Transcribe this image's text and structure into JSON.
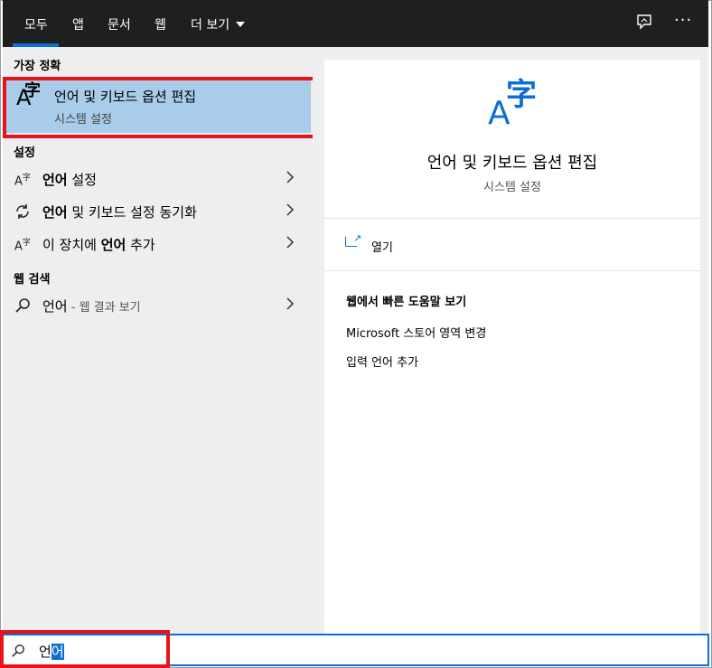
{
  "tabs": [
    {
      "label": "모두",
      "selected": true
    },
    {
      "label": "앱"
    },
    {
      "label": "문서"
    },
    {
      "label": "웹"
    },
    {
      "label": "더 보기"
    }
  ],
  "topbar_icons": [
    "feedback-icon",
    "more-options-icon"
  ],
  "best_match": {
    "header": "가장 정확",
    "title": "언어 및 키보드 옵션 편집",
    "subtitle": "시스템 설정",
    "icon": "language-icon"
  },
  "settings": {
    "header": "설정",
    "items": [
      {
        "icon": "language-icon",
        "label_bold": "언어",
        "label_rest": " 설정"
      },
      {
        "icon": "sync-icon",
        "label_bold": "언어",
        "label_rest": " 및 키보드 설정 동기화"
      },
      {
        "icon": "language-icon",
        "label_pre": "이 장치에 ",
        "label_bold": "언어",
        "label_rest": " 추가"
      }
    ]
  },
  "web_search": {
    "header": "웹 검색",
    "item": {
      "icon": "search-icon",
      "label": "언어",
      "suffix": " - 웹 결과 보기"
    }
  },
  "preview": {
    "title": "언어 및 키보드 옵션 편집",
    "subtitle": "시스템 설정",
    "open_label": "열기",
    "help_header": "웹에서 빠른 도움말 보기",
    "help_links": [
      "Microsoft 스토어 영역 변경",
      "입력 언어 추가"
    ]
  },
  "search": {
    "value_prefix": "언",
    "value_selected": "어"
  },
  "colors": {
    "accent": "#0a6fd6",
    "highlight": "#a8cce9",
    "annotation_red": "#e8121b",
    "topbar": "#1f1f1f"
  }
}
